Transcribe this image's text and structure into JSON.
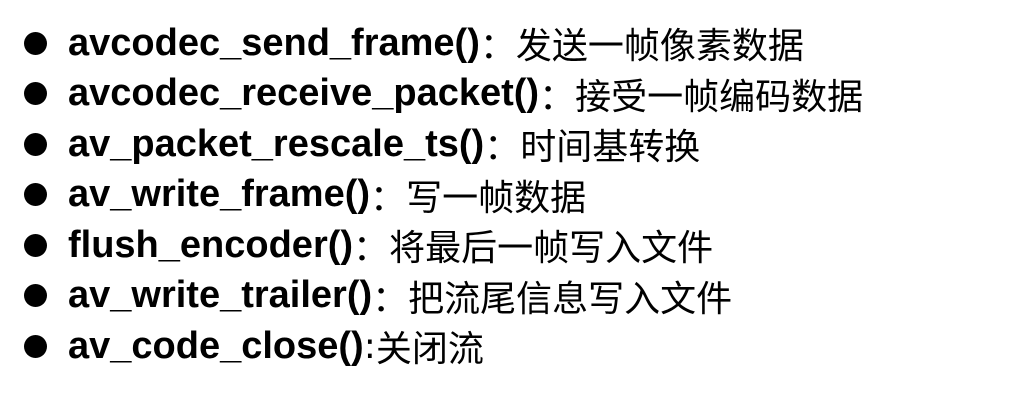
{
  "items": [
    {
      "fn": "avcodec_send_frame()",
      "sep": "：",
      "desc": "发送一帧像素数据"
    },
    {
      "fn": "avcodec_receive_packet()",
      "sep": "：",
      "desc": "接受一帧编码数据"
    },
    {
      "fn": "av_packet_rescale_ts()",
      "sep": "：",
      "desc": "时间基转换"
    },
    {
      "fn": "av_write_frame()",
      "sep": "：",
      "desc": "写一帧数据"
    },
    {
      "fn": "flush_encoder()",
      "sep": "：",
      "desc": "将最后一帧写入文件"
    },
    {
      "fn": "av_write_trailer()",
      "sep": "：",
      "desc": "把流尾信息写入文件"
    },
    {
      "fn": "av_code_close()",
      "sep": ":",
      "desc": "关闭流"
    }
  ]
}
